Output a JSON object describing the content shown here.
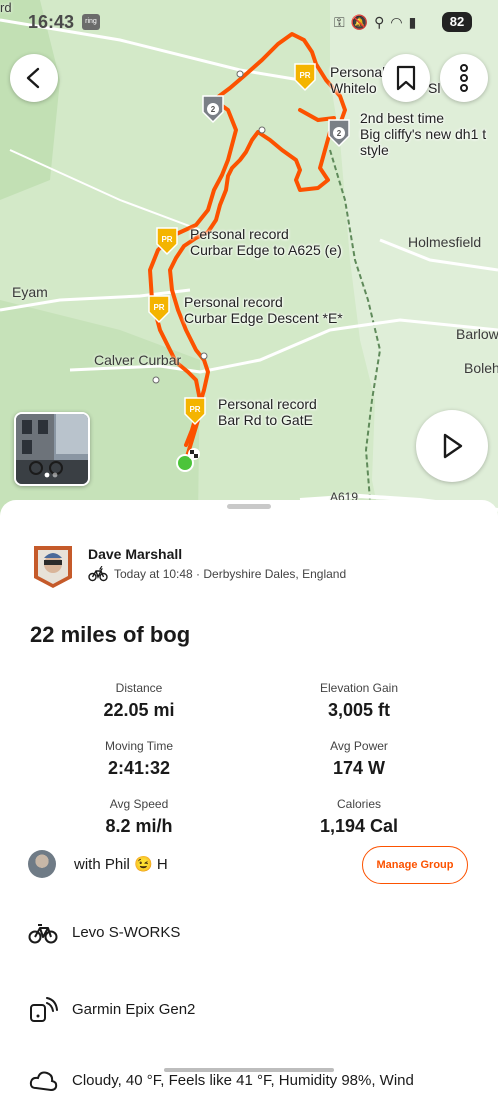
{
  "status_bar": {
    "time": "16:43",
    "ring_badge": "ring",
    "battery": "82"
  },
  "map": {
    "place_labels": {
      "top_left": "rd",
      "holmesfield": "Holmesfield",
      "eyam": "Eyam",
      "barlow": "Barlow",
      "boleh": "Boleh",
      "calver": "Calver Curbar",
      "road": "A619"
    },
    "segments": [
      {
        "line1": "Personal",
        "line2": "Whitelo",
        "line3": "Sl",
        "badge": "PR"
      },
      {
        "line1": "2nd best time",
        "line2": "Big cliffy's new dh1 t",
        "line3": "style",
        "badge": "2"
      },
      {
        "line1": "Personal record",
        "line2": "Curbar Edge to A625 (e)",
        "badge": "PR"
      },
      {
        "line1": "Personal record",
        "line2": "Curbar Edge Descent *E*",
        "badge": "PR"
      },
      {
        "line1": "Personal record",
        "line2": "Bar Rd to GatE",
        "badge": "PR"
      }
    ],
    "extra_badge": "2",
    "icons": {
      "back": "back-chevron-icon",
      "bookmark": "bookmark-icon",
      "more": "more-vertical-icon",
      "play": "play-icon"
    },
    "colors": {
      "route": "#fc5200",
      "badge_gold": "#f4b400",
      "badge_grey": "#7a7f86",
      "start": "#4cc43a"
    }
  },
  "activity": {
    "athlete_name": "Dave Marshall",
    "meta": "Today at 10:48 · Derbyshire Dales, England",
    "title": "22 miles of bog",
    "stats": [
      {
        "label": "Distance",
        "value": "22.05 mi"
      },
      {
        "label": "Elevation Gain",
        "value": "3,005 ft"
      },
      {
        "label": "Moving Time",
        "value": "2:41:32"
      },
      {
        "label": "Avg Power",
        "value": "174 W"
      },
      {
        "label": "Avg Speed",
        "value": "8.2 mi/h"
      },
      {
        "label": "Calories",
        "value": "1,194 Cal"
      }
    ],
    "group": {
      "text": "with Phil 😉 H",
      "manage_label": "Manage Group"
    },
    "gear": "Levo S-WORKS",
    "device": "Garmin Epix Gen2",
    "weather": "Cloudy, 40 °F, Feels like 41 °F, Humidity 98%, Wind"
  }
}
